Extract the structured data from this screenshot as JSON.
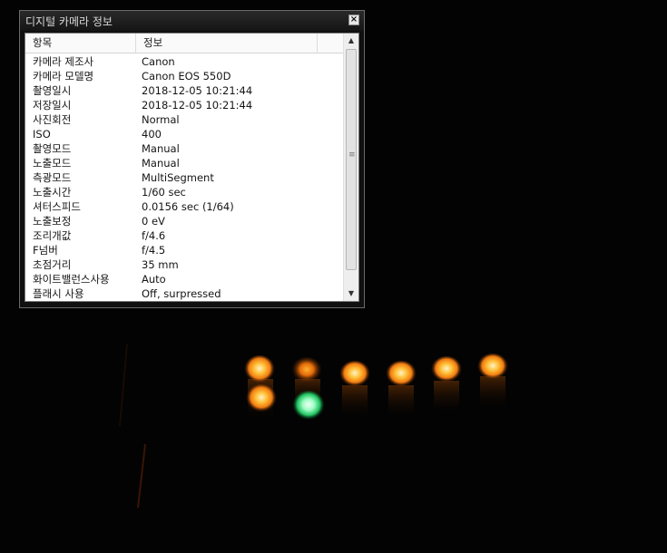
{
  "window": {
    "title": "디지털 카메라 정보",
    "close_glyph": "×"
  },
  "columns": {
    "item": "항목",
    "info": "정보"
  },
  "rows": [
    {
      "item": "카메라 제조사",
      "value": "Canon"
    },
    {
      "item": "카메라 모델명",
      "value": "Canon EOS 550D"
    },
    {
      "item": "촬영일시",
      "value": "2018-12-05  10:21:44"
    },
    {
      "item": "저장일시",
      "value": "2018-12-05  10:21:44"
    },
    {
      "item": "사진회전",
      "value": "Normal"
    },
    {
      "item": "ISO",
      "value": "400"
    },
    {
      "item": "촬영모드",
      "value": "Manual"
    },
    {
      "item": "노출모드",
      "value": "Manual"
    },
    {
      "item": "측광모드",
      "value": "MultiSegment"
    },
    {
      "item": "노출시간",
      "value": "1/60 sec"
    },
    {
      "item": "셔터스피드",
      "value": "0.0156 sec  (1/64)"
    },
    {
      "item": "노출보정",
      "value": "0 eV"
    },
    {
      "item": "조리개값",
      "value": "f/4.6"
    },
    {
      "item": "F넘버",
      "value": "f/4.5"
    },
    {
      "item": "초점거리",
      "value": "35 mm"
    },
    {
      "item": "화이트밸런스사용",
      "value": "Auto"
    },
    {
      "item": "플래시 사용",
      "value": "Off, surpressed"
    }
  ],
  "scrollbar": {
    "up_glyph": "▲",
    "down_glyph": "▼",
    "grip_glyph": "≡"
  },
  "colors": {
    "background": "#030303",
    "window_bg": "#101010",
    "led_orange": "#ff9a2a",
    "led_green": "#5dff9a"
  }
}
